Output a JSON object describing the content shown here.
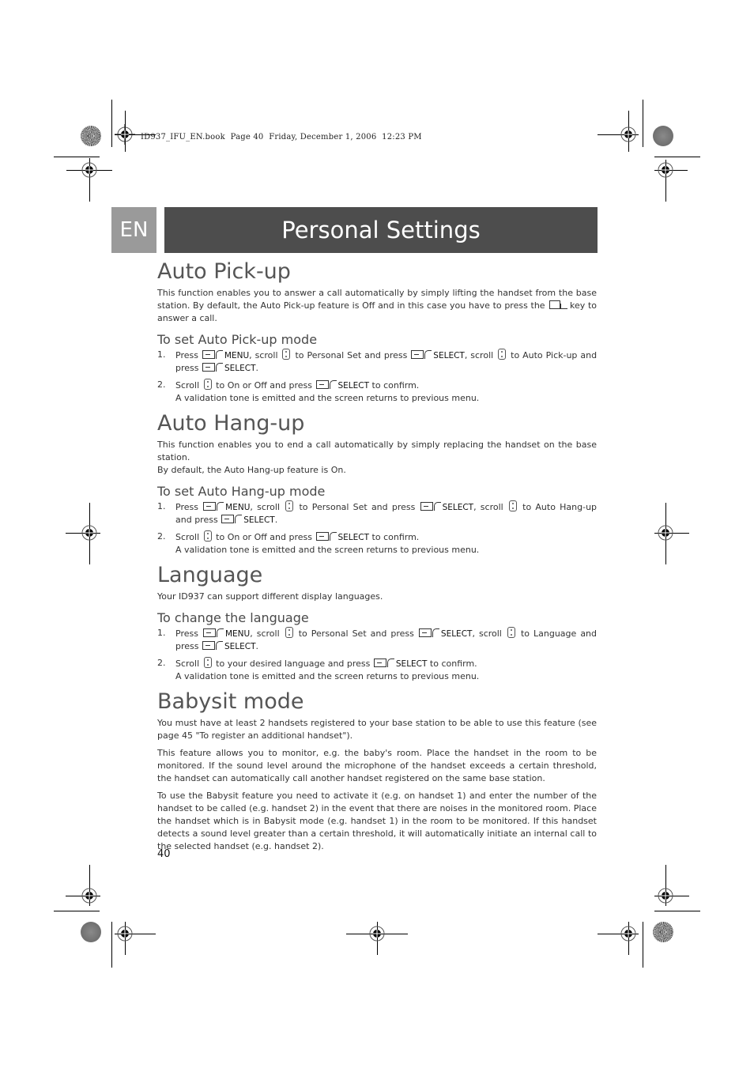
{
  "print_header": "ID937_IFU_EN.book  Page 40  Friday, December 1, 2006  12:23 PM",
  "language_tab": "EN",
  "chapter_title": "Personal Settings",
  "sections": {
    "auto_pickup": {
      "heading": "Auto Pick-up",
      "intro_1": "This function enables you to answer a call automatically by simply lifting the handset from the base station. By default, the Auto Pick-up feature is Off and in this case you have to press the",
      "intro_2": "key to answer a call.",
      "subheading": "To set Auto Pick-up mode",
      "steps": [
        {
          "num": "1.",
          "t1": "Press",
          "k1": "MENU",
          "t2": ", scroll",
          "t3": "to Personal Set and press",
          "k2": "SELECT",
          "t4": ", scroll",
          "t5": "to Auto Pick-up and press",
          "k3": "SELECT",
          "t6": "."
        },
        {
          "num": "2.",
          "t1": "Scroll",
          "t2": "to On or Off and press",
          "k1": "SELECT",
          "t3": "to confirm.",
          "note": "A validation tone is emitted and the screen returns to previous menu."
        }
      ]
    },
    "auto_hangup": {
      "heading": "Auto Hang-up",
      "intro_1": "This function enables you to end a call automatically by simply replacing the handset on the base station.",
      "intro_2": "By default, the Auto Hang-up feature is On.",
      "subheading": "To set Auto Hang-up mode",
      "steps": [
        {
          "num": "1.",
          "t1": "Press",
          "k1": "MENU",
          "t2": ", scroll",
          "t3": "to Personal Set and press",
          "k2": "SELECT",
          "t4": ", scroll",
          "t5": "to Auto Hang-up and press",
          "k3": "SELECT",
          "t6": "."
        },
        {
          "num": "2.",
          "t1": "Scroll",
          "t2": "to On or Off and press",
          "k1": "SELECT",
          "t3": "to confirm.",
          "note": "A validation tone is emitted and the screen returns to previous menu."
        }
      ]
    },
    "language": {
      "heading": "Language",
      "intro_1": "Your ID937 can support different display languages.",
      "subheading": "To change the language",
      "steps": [
        {
          "num": "1.",
          "t1": "Press",
          "k1": "MENU",
          "t2": ", scroll",
          "t3": "to Personal Set and press",
          "k2": "SELECT",
          "t4": ", scroll",
          "t5": "to Language and press",
          "k3": "SELECT",
          "t6": "."
        },
        {
          "num": "2.",
          "t1": "Scroll",
          "t2": "to your desired language and press",
          "k1": "SELECT",
          "t3": "to confirm.",
          "note": "A validation tone is emitted and the screen returns to previous menu."
        }
      ]
    },
    "babysit": {
      "heading": "Babysit mode",
      "paragraphs": [
        "You must have at least 2 handsets registered to your base station to be able to use this feature (see page 45 \"To register an additional handset\").",
        "This feature allows you to monitor, e.g. the baby's room. Place the handset in the room to be monitored. If the sound level around the microphone of the handset exceeds a certain threshold, the handset can automatically call another handset registered on the same base station.",
        "To use the Babysit feature you need to activate it (e.g. on handset 1) and enter the number of the handset to be called (e.g. handset 2) in the event that there are noises in the monitored room. Place the handset which is in Babysit mode (e.g. handset 1) in the room to be monitored. If this handset detects a sound level greater than a certain threshold, it will automatically initiate an internal call to the selected handset (e.g. handset 2)."
      ]
    }
  },
  "page_number": "40"
}
